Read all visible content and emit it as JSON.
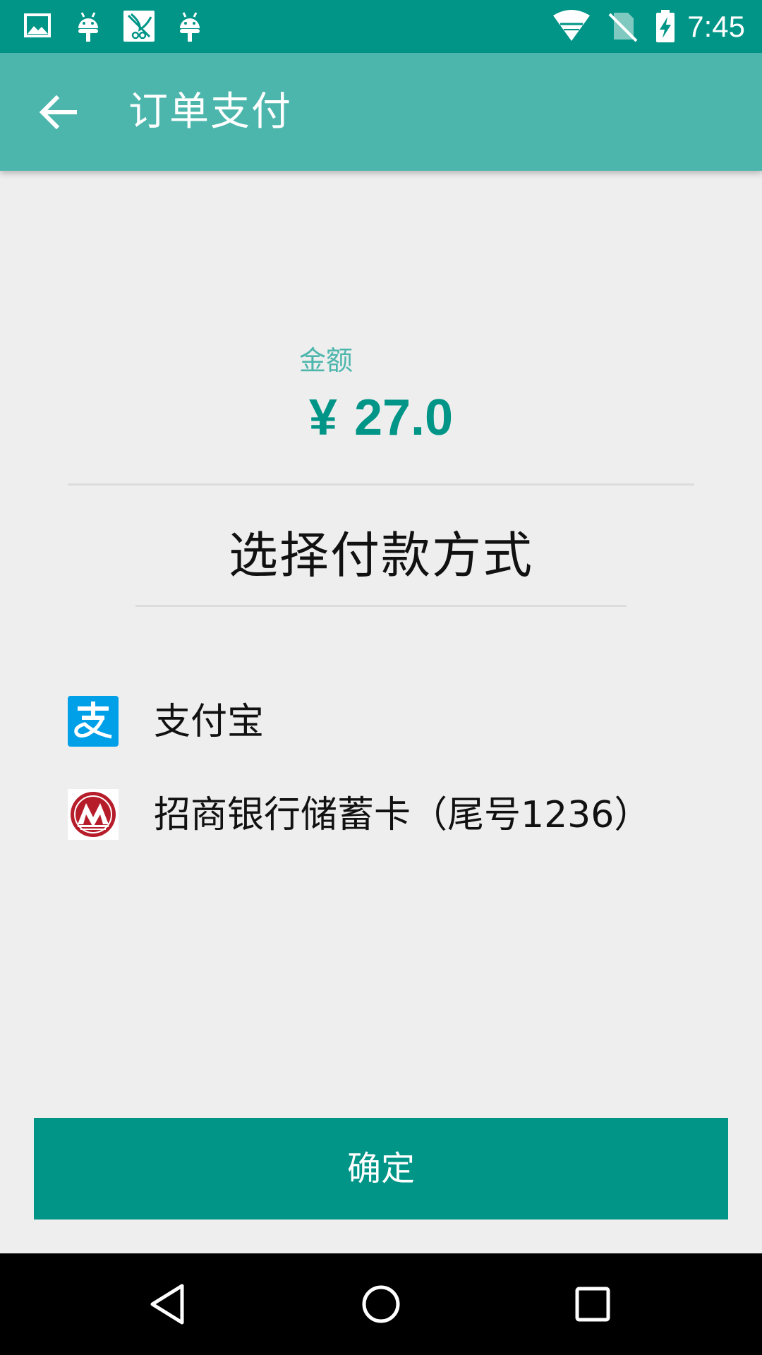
{
  "status_bar": {
    "time": "7:45",
    "left_icons": [
      "image-icon",
      "android-icon",
      "app-notification-icon",
      "android-icon"
    ],
    "right_icons": [
      "wifi-icon",
      "no-sim-icon",
      "battery-charging-icon"
    ]
  },
  "app_bar": {
    "title": "订单支付",
    "back_icon": "arrow-back-icon"
  },
  "amount": {
    "label": "金额",
    "currency": "¥",
    "value": "27.0"
  },
  "payment": {
    "section_title": "选择付款方式",
    "options": [
      {
        "label": "支付宝",
        "icon": "alipay-icon"
      },
      {
        "label": "招商银行储蓄卡（尾号1236）",
        "icon": "cmb-bank-icon"
      }
    ]
  },
  "confirm_button": {
    "label": "确定"
  },
  "colors": {
    "primary_dark": "#009587",
    "primary": "#4DB6AC",
    "background": "#EEEEEE",
    "alipay_blue": "#00A0E9",
    "cmb_red": "#B71C2A"
  },
  "nav_bar": {
    "icons": [
      "back-triangle-icon",
      "home-circle-icon",
      "recents-square-icon"
    ]
  }
}
